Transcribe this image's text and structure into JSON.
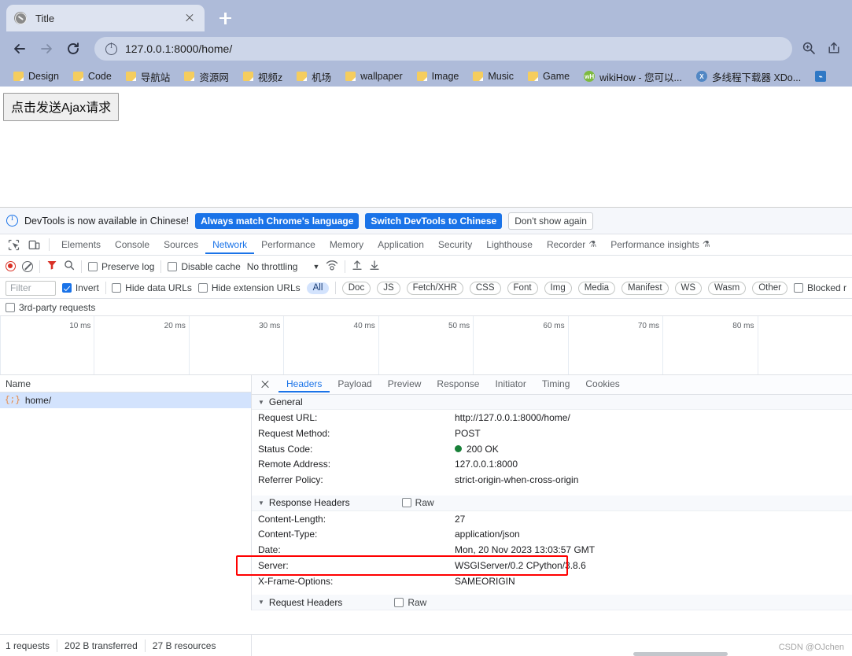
{
  "browser": {
    "tab": {
      "title": "Title",
      "favicon": "globe-icon",
      "close": "close-icon"
    },
    "new_tab": "+",
    "nav": {
      "back": "back-arrow-icon",
      "forward": "forward-arrow-icon",
      "reload": "reload-icon"
    },
    "omnibox": {
      "url": "127.0.0.1:8000/home/",
      "info_icon": "info-circle-icon"
    },
    "toolbar_right": {
      "zoom": "zoom-in-icon",
      "share": "share-icon"
    },
    "bookmarks": [
      {
        "label": "Design",
        "icon": "folder-icon"
      },
      {
        "label": "Code",
        "icon": "folder-icon"
      },
      {
        "label": "导航站",
        "icon": "folder-icon"
      },
      {
        "label": "资源网",
        "icon": "folder-icon"
      },
      {
        "label": "视频z",
        "icon": "folder-icon"
      },
      {
        "label": "机场",
        "icon": "folder-icon"
      },
      {
        "label": "wallpaper",
        "icon": "folder-icon"
      },
      {
        "label": "Image",
        "icon": "folder-icon"
      },
      {
        "label": "Music",
        "icon": "folder-icon"
      },
      {
        "label": "Game",
        "icon": "folder-icon"
      },
      {
        "label": "wikiHow - 您可以...",
        "icon": "wikihow-icon"
      },
      {
        "label": "多线程下载器 XDo...",
        "icon": "xdown-icon"
      }
    ],
    "colors": {
      "chrome_bg": "#aebbd9",
      "tab_bg": "#dde3f0",
      "omnibox_bg": "#cdd6e9"
    }
  },
  "page": {
    "button_label": "点击发送Ajax请求"
  },
  "devtools": {
    "notice": {
      "message": "DevTools is now available in Chinese!",
      "info_icon": "info-circle-icon",
      "buttons": [
        {
          "label": "Always match Chrome's language",
          "style": "primary"
        },
        {
          "label": "Switch DevTools to Chinese",
          "style": "primary"
        },
        {
          "label": "Don't show again",
          "style": "plain"
        }
      ]
    },
    "left_icons": [
      {
        "name": "inspect-element-icon"
      },
      {
        "name": "device-toolbar-icon"
      }
    ],
    "panels": [
      {
        "label": "Elements",
        "active": false
      },
      {
        "label": "Console",
        "active": false
      },
      {
        "label": "Sources",
        "active": false
      },
      {
        "label": "Network",
        "active": true
      },
      {
        "label": "Performance",
        "active": false
      },
      {
        "label": "Memory",
        "active": false
      },
      {
        "label": "Application",
        "active": false
      },
      {
        "label": "Security",
        "active": false
      },
      {
        "label": "Lighthouse",
        "active": false
      },
      {
        "label": "Recorder",
        "active": false,
        "badge": "⚗"
      },
      {
        "label": "Performance insights",
        "active": false,
        "badge": "⚗"
      }
    ],
    "network_toolbar": {
      "record_icon": "record-stop-icon",
      "clear_icon": "clear-icon",
      "filter_icon": "filter-funnel-icon",
      "search_icon": "search-icon",
      "preserve_log": {
        "label": "Preserve log",
        "checked": false
      },
      "disable_cache": {
        "label": "Disable cache",
        "checked": false
      },
      "throttling": {
        "value": "No throttling",
        "caret": "chevron-down-icon"
      },
      "wifi_icon": "network-conditions-icon",
      "import_icon": "import-har-icon",
      "export_icon": "export-har-icon"
    },
    "filter_bar": {
      "filter_placeholder": "Filter",
      "filter_value": "",
      "invert": {
        "label": "Invert",
        "checked": true
      },
      "hide_data_urls": {
        "label": "Hide data URLs",
        "checked": false
      },
      "hide_extension_urls": {
        "label": "Hide extension URLs",
        "checked": false
      },
      "types": [
        "All",
        "Doc",
        "JS",
        "Fetch/XHR",
        "CSS",
        "Font",
        "Img",
        "Media",
        "Manifest",
        "WS",
        "Wasm",
        "Other"
      ],
      "active_type": "All",
      "blocked": {
        "label": "Blocked r",
        "checked": false
      },
      "third_party": {
        "label": "3rd-party requests",
        "checked": false
      }
    },
    "overview_ticks": [
      "10 ms",
      "20 ms",
      "30 ms",
      "40 ms",
      "50 ms",
      "60 ms",
      "70 ms",
      "80 ms",
      ""
    ],
    "request_list": {
      "header": "Name",
      "rows": [
        {
          "name": "home/",
          "icon": "json-icon",
          "selected": true
        }
      ]
    },
    "detail_tabs": [
      {
        "label": "Headers",
        "active": true
      },
      {
        "label": "Payload",
        "active": false
      },
      {
        "label": "Preview",
        "active": false
      },
      {
        "label": "Response",
        "active": false
      },
      {
        "label": "Initiator",
        "active": false
      },
      {
        "label": "Timing",
        "active": false
      },
      {
        "label": "Cookies",
        "active": false
      }
    ],
    "close_icon": "close-icon",
    "sections": [
      {
        "title": "General",
        "raw_toggle": null,
        "rows": [
          {
            "key": "Request URL:",
            "value": "http://127.0.0.1:8000/home/"
          },
          {
            "key": "Request Method:",
            "value": "POST"
          },
          {
            "key": "Status Code:",
            "value": "200 OK",
            "status_dot": "#188038"
          },
          {
            "key": "Remote Address:",
            "value": "127.0.0.1:8000"
          },
          {
            "key": "Referrer Policy:",
            "value": "strict-origin-when-cross-origin"
          }
        ]
      },
      {
        "title": "Response Headers",
        "raw_toggle": {
          "label": "Raw",
          "checked": false
        },
        "rows": [
          {
            "key": "Content-Length:",
            "value": "27"
          },
          {
            "key": "Content-Type:",
            "value": "application/json",
            "highlighted": true
          },
          {
            "key": "Date:",
            "value": "Mon, 20 Nov 2023 13:03:57 GMT"
          },
          {
            "key": "Server:",
            "value": "WSGIServer/0.2 CPython/3.8.6"
          },
          {
            "key": "X-Frame-Options:",
            "value": "SAMEORIGIN"
          }
        ]
      },
      {
        "title": "Request Headers",
        "raw_toggle": {
          "label": "Raw",
          "checked": false
        },
        "rows": []
      }
    ],
    "status_bar": {
      "requests": "1 requests",
      "transferred": "202 B transferred",
      "resources": "27 B resources"
    }
  },
  "watermark": "CSDN @OJchen",
  "annotation": {
    "color": "#ff0000",
    "target": "Content-Type:"
  }
}
